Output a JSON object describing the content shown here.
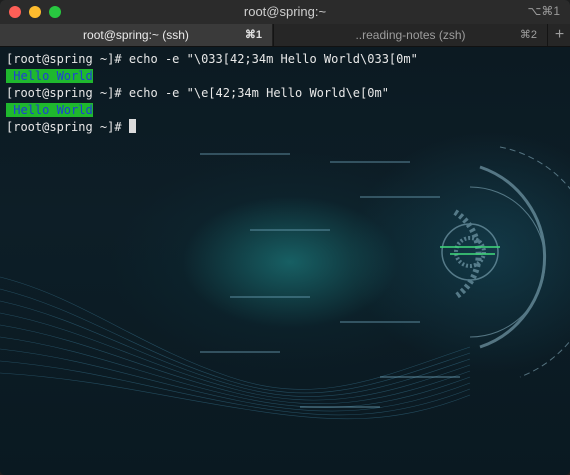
{
  "window": {
    "title": "root@spring:~",
    "shortcut": "⌥⌘1"
  },
  "tabs": [
    {
      "label": "root@spring:~ (ssh)",
      "key": "⌘1",
      "active": true
    },
    {
      "label": "..reading-notes (zsh)",
      "key": "⌘2",
      "active": false
    }
  ],
  "new_tab_icon": "+",
  "terminal": {
    "lines": [
      {
        "prompt": "[root@spring ~]#",
        "command": "echo -e \"\\033[42;34m Hello World\\033[0m\""
      },
      {
        "output": " Hello World"
      },
      {
        "prompt": "[root@spring ~]#",
        "command": "echo -e \"\\e[42;34m Hello World\\e[0m\""
      },
      {
        "output": " Hello World"
      },
      {
        "prompt": "[root@spring ~]#",
        "command": ""
      }
    ]
  },
  "colors": {
    "output_background": "#1fb82e",
    "output_text": "#1f3fd6"
  }
}
